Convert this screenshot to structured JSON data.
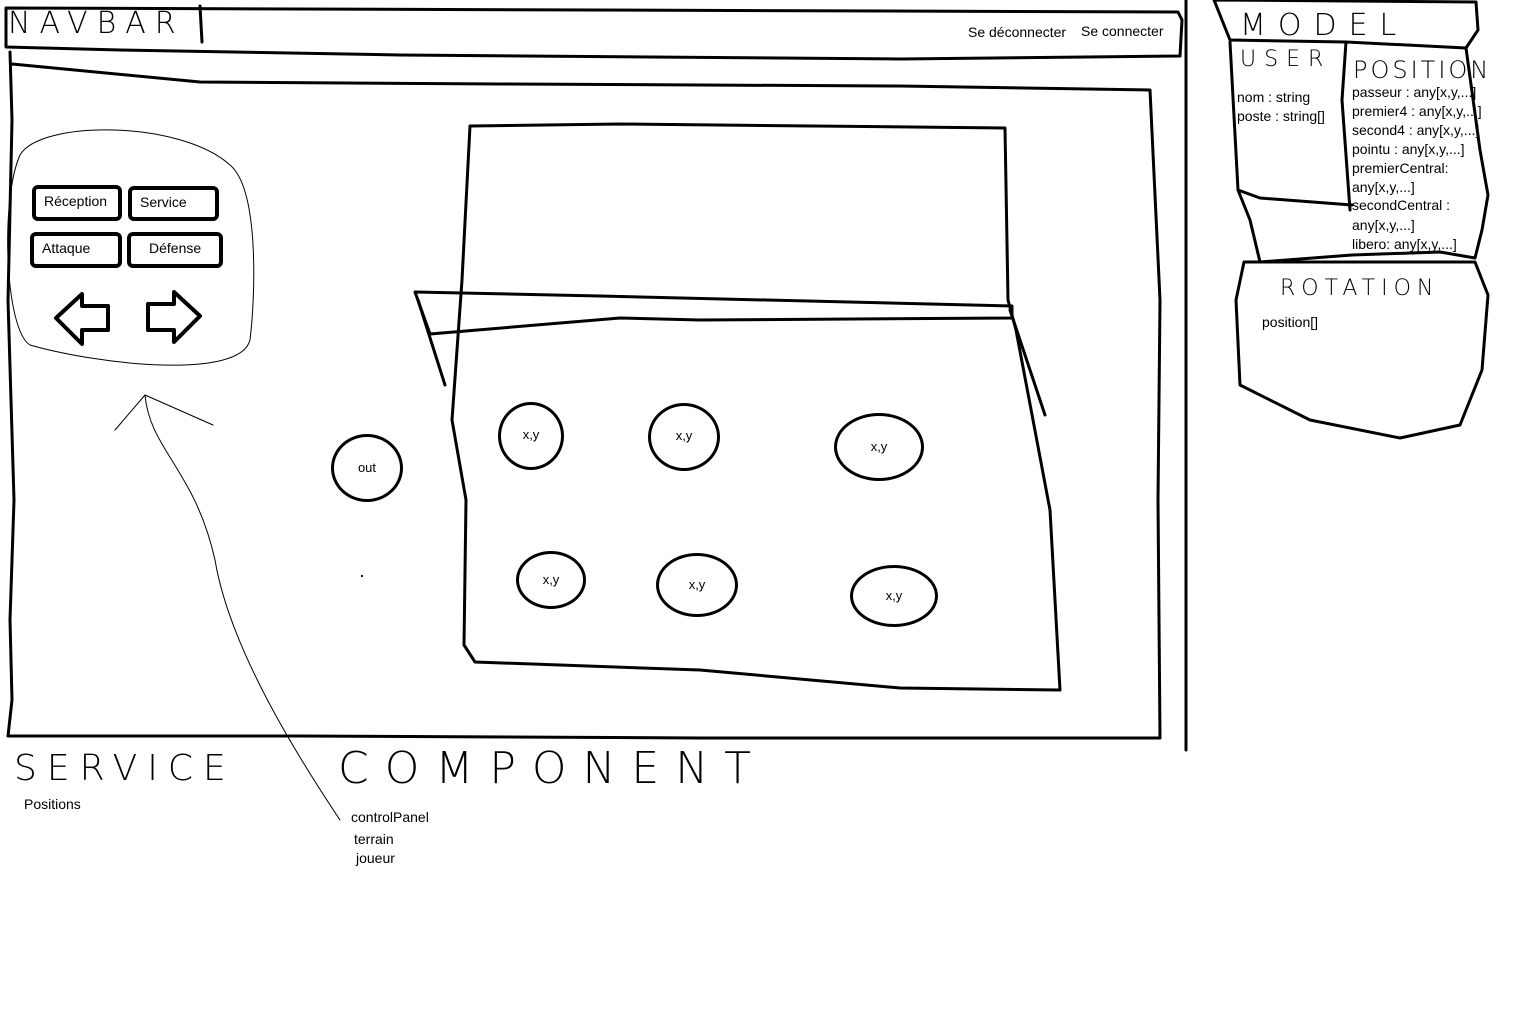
{
  "navbar": {
    "title": "NAVBAR",
    "links": [
      "Se déconnecter",
      "Se connecter"
    ]
  },
  "control_panel": {
    "buttons": [
      "Réception",
      "Service",
      "Attaque",
      "Défense"
    ],
    "prev_icon": "arrow-left-icon",
    "next_icon": "arrow-right-icon"
  },
  "court": {
    "out_label": "out",
    "players": [
      "x,y",
      "x,y",
      "x,y",
      "x,y",
      "x,y",
      "x,y"
    ]
  },
  "service_section": {
    "title": "SERVICE",
    "items": [
      "Positions"
    ]
  },
  "component_section": {
    "title": "COMPONENT",
    "items": [
      "controlPanel",
      "terrain",
      "joueur"
    ]
  },
  "model": {
    "title": "MODEL",
    "user": {
      "title": "USER",
      "fields": [
        "nom : string",
        "poste : string[]"
      ]
    },
    "position": {
      "title": "POSITION",
      "fields": [
        "passeur : any[x,y,...]",
        "premier4 : any[x,y,...]",
        "second4 : any[x,y,...]",
        "pointu : any[x,y,...]",
        "premierCentral:",
        "any[x,y,...]",
        " secondCentral :",
        "any[x,y,...]",
        "libero: any[x,y,...]"
      ]
    },
    "rotation": {
      "title": "ROTATION",
      "fields": [
        "position[]"
      ]
    }
  }
}
